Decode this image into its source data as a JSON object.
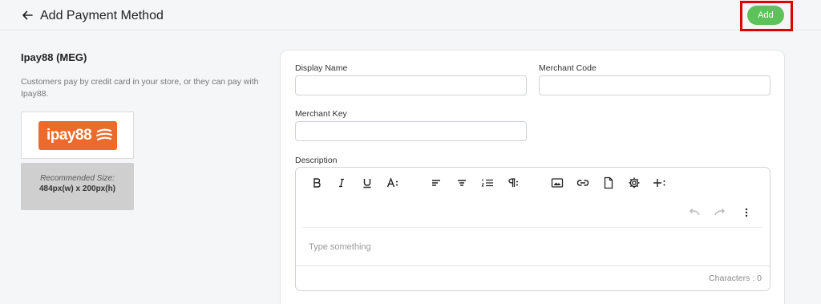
{
  "header": {
    "title": "Add Payment Method",
    "add_label": "Add"
  },
  "method": {
    "name": "Ipay88 (MEG)",
    "description": "Customers pay by credit card in your store, or they can pay with Ipay88.",
    "logo_text": "ipay88",
    "recommended_label": "Recommended Size:",
    "recommended_size": "484px(w) x 200px(h)"
  },
  "form": {
    "display_name": {
      "label": "Display Name",
      "value": ""
    },
    "merchant_code": {
      "label": "Merchant Code",
      "value": ""
    },
    "merchant_key": {
      "label": "Merchant Key",
      "value": ""
    },
    "description": {
      "label": "Description",
      "placeholder": "Type something",
      "characters": "Characters : 0"
    }
  },
  "toolbar_icons": [
    "bold-icon",
    "italic-icon",
    "underline-icon",
    "font-size-icon",
    "align-left-icon",
    "align-center-icon",
    "numbered-list-icon",
    "paragraph-icon",
    "image-icon",
    "link-icon",
    "file-icon",
    "settings-icon",
    "insert-more-icon",
    "undo-icon",
    "redo-icon",
    "more-vertical-icon"
  ],
  "colors": {
    "accent_green": "#5dc25a",
    "highlight_red": "#e00000",
    "logo_orange": "#ec6a2c"
  }
}
